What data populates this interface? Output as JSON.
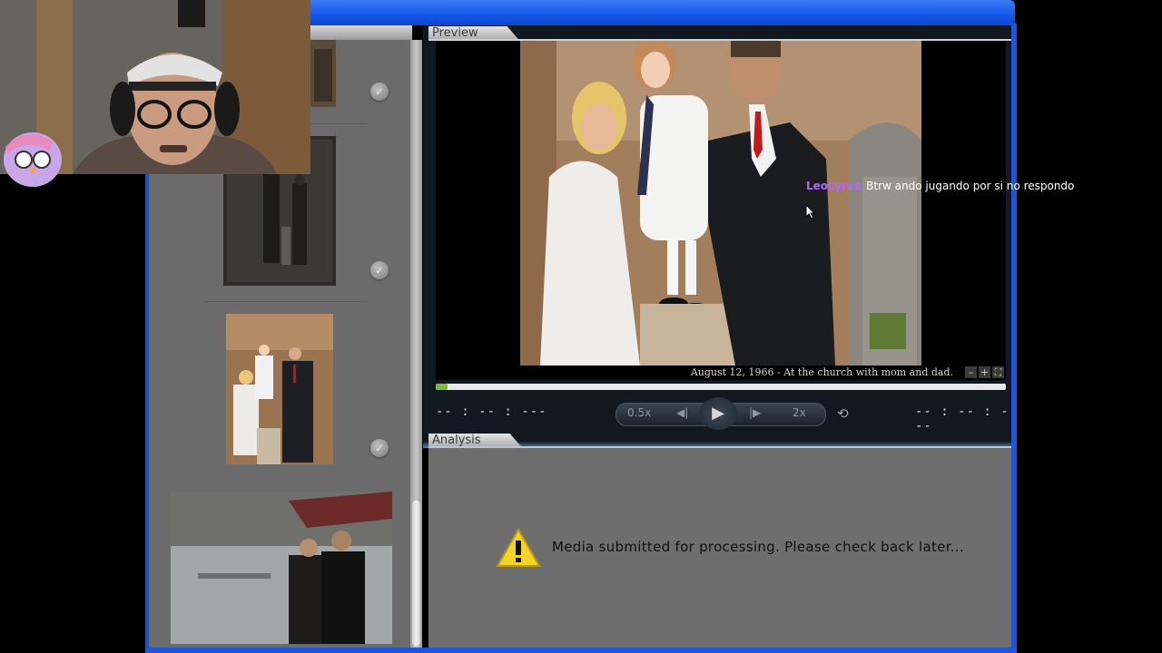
{
  "app": {
    "preview_tab": "Preview",
    "analysis_tab": "Analysis"
  },
  "player": {
    "caption": "August 12, 1966 - At the church with mom and dad.",
    "zoom_out": "–",
    "zoom_in": "+",
    "fullscreen_icon": "fullscreen-icon",
    "time_elapsed": "-- : -- : ---",
    "time_total": "-- : -- : ---",
    "speed_slow": "0.5x",
    "speed_fast": "2x",
    "progress": 0.02
  },
  "analysis": {
    "message": "Media submitted for processing. Please check back later..."
  },
  "thumbnails": [
    {
      "name": "photo-church-doorway",
      "selected": false
    },
    {
      "name": "photo-old-family-bw",
      "selected": false
    },
    {
      "name": "photo-church-mom-dad",
      "selected": true
    },
    {
      "name": "photo-harbor-couple",
      "selected": false
    }
  ],
  "chat": {
    "user": "Leocyres",
    "text": "Btrw ando jugando por si no respondo"
  },
  "colors": {
    "titlebar": "#1556e6",
    "panel_gray": "#6b6b6b",
    "player_dark": "#121820",
    "progress_green": "#7dbb3c",
    "chat_user": "#b566ff"
  }
}
